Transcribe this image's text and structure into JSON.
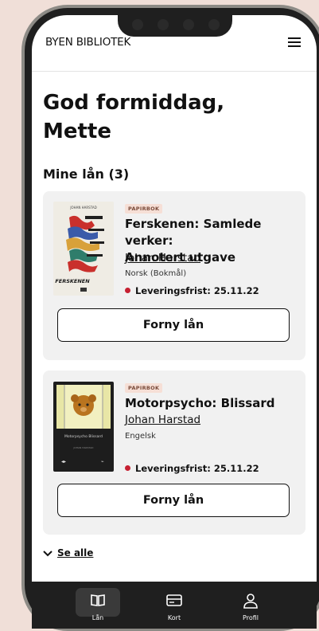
{
  "header": {
    "brand": "BYEN BIBLIOTEK",
    "menu_icon": "hamburger-menu-icon"
  },
  "greeting": {
    "line1": "God formiddag,",
    "line2": "Mette"
  },
  "loans": {
    "heading": "Mine lån (3)",
    "items": [
      {
        "badge": "PAPIRBOK",
        "title_line1": "Ferskenen: Samlede verker:",
        "title_line2": "Annotert utgave",
        "author": "Johan Harstad",
        "language": "Norsk (Bokmål)",
        "due": "Leveringsfrist: 25.11.22",
        "renew_label": "Forny lån",
        "cover_title": "FERSKENEN"
      },
      {
        "badge": "PAPIRBOK",
        "title_line1": "Motorpsycho: Blissard",
        "title_line2": "",
        "author": "Johan Harstad",
        "language": "Engelsk",
        "due": "Leveringsfrist: 25.11.22",
        "renew_label": "Forny lån",
        "cover_title": "Motorpsycho Blissard"
      }
    ]
  },
  "see_all": "Se alle",
  "bottom_nav": {
    "items": [
      {
        "label": "Lån",
        "icon": "book-icon",
        "active": true
      },
      {
        "label": "Kort",
        "icon": "card-icon",
        "active": false
      },
      {
        "label": "Profil",
        "icon": "person-icon",
        "active": false
      }
    ]
  },
  "colors": {
    "due_dot": "#c62032",
    "badge_bg": "#f6dfd6",
    "card_bg": "#f1f1f1",
    "page_bg": "#f0dfd8"
  }
}
